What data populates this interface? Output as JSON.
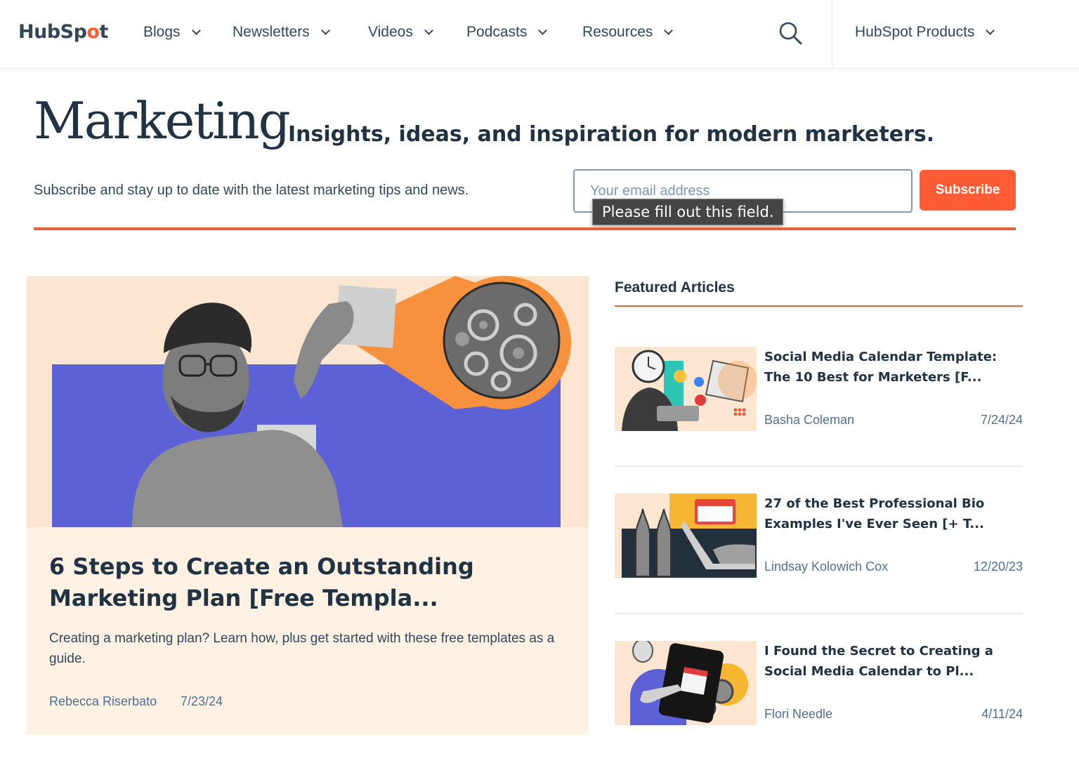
{
  "brand": {
    "logo_text_pre": "HubSp",
    "logo_text_o": "o",
    "logo_text_post": "t"
  },
  "nav": {
    "items": [
      {
        "label": "Blogs"
      },
      {
        "label": "Newsletters"
      },
      {
        "label": "Videos"
      },
      {
        "label": "Podcasts"
      },
      {
        "label": "Resources"
      }
    ],
    "products_label": "HubSpot Products"
  },
  "hero": {
    "title": "Marketing",
    "tagline": "Insights, ideas, and inspiration for modern marketers.",
    "subscribe_text": "Subscribe and stay up to date with the latest marketing tips and news.",
    "email_placeholder": "Your email address",
    "subscribe_button": "Subscribe",
    "validation_tooltip": "Please fill out this field."
  },
  "main_article": {
    "title": "6 Steps to Create an Outstanding Marketing Plan [Free Templa...",
    "description": "Creating a marketing plan? Learn how, plus get started with these free templates as a guide.",
    "author": "Rebecca Riserbato",
    "date": "7/23/24"
  },
  "featured": {
    "heading": "Featured Articles",
    "articles": [
      {
        "title": "Social Media Calendar Template: The 10 Best for Marketers [F...",
        "author": "Basha Coleman",
        "date": "7/24/24"
      },
      {
        "title": "27 of the Best Professional Bio Examples I've Ever Seen [+ T...",
        "author": "Lindsay Kolowich Cox",
        "date": "12/20/23"
      },
      {
        "title": "I Found the Secret to Creating a Social Media Calendar to Pl...",
        "author": "Flori Needle",
        "date": "4/11/24"
      }
    ]
  },
  "colors": {
    "accent": "#ff5c35",
    "text": "#213343",
    "muted": "#516f90",
    "card_bg": "#fdf1e4",
    "purple": "#5c62d6"
  }
}
